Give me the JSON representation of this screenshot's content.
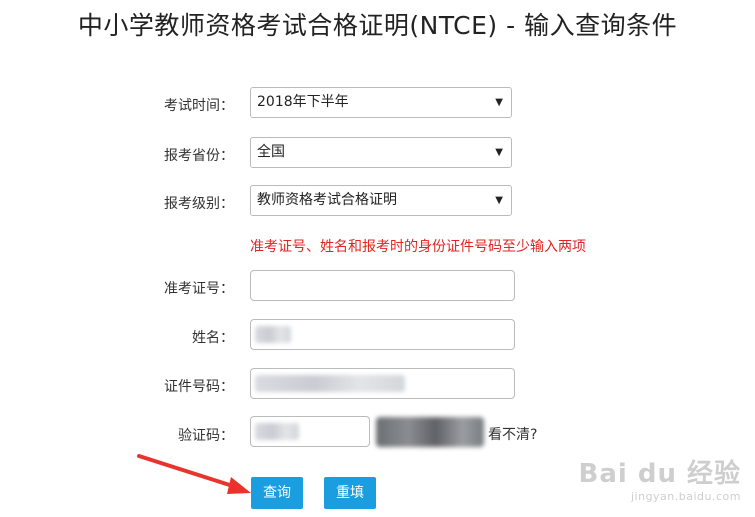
{
  "page": {
    "title": "中小学教师资格考试合格证明(NTCE) - 输入查询条件"
  },
  "form": {
    "exam_time": {
      "label": "考试时间：",
      "value": "2018年下半年"
    },
    "province": {
      "label": "报考省份：",
      "value": "全国"
    },
    "level": {
      "label": "报考级别：",
      "value": "教师资格考试合格证明"
    },
    "hint": "准考证号、姓名和报考时的身份证件号码至少输入两项",
    "ticket_no": {
      "label": "准考证号：",
      "value": ""
    },
    "name": {
      "label": "姓名：",
      "value": ""
    },
    "id_no": {
      "label": "证件号码：",
      "value": ""
    },
    "captcha": {
      "label": "验证码：",
      "value": "",
      "refresh_text": "看不清?"
    },
    "query_button": "查询",
    "reset_button": "重填"
  },
  "colors": {
    "hint": "#e02424",
    "button": "#1b9ee0",
    "annotation_arrow": "#e8342c"
  },
  "watermark": {
    "main": "Bai du 经验",
    "sub": "jingyan.baidu.com"
  }
}
